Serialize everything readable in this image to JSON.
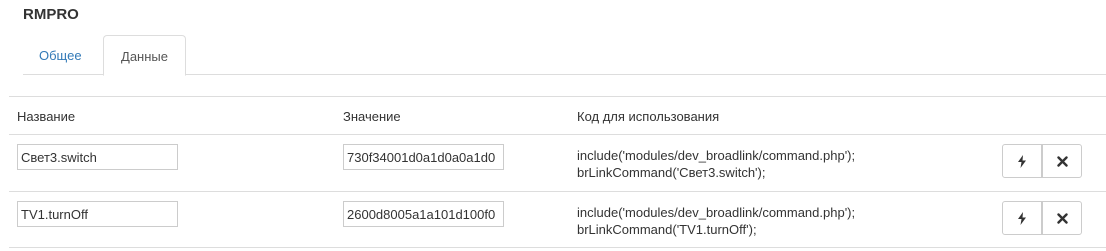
{
  "header": {
    "title": "RMPRO"
  },
  "tabs": [
    {
      "label": "Общее",
      "active": false
    },
    {
      "label": "Данные",
      "active": true
    }
  ],
  "table": {
    "columns": [
      "Название",
      "Значение",
      "Код для использования"
    ],
    "rows": [
      {
        "name": "Свет3.switch",
        "value": "730f34001d0a1d0a0a1d0",
        "code_line1": "include('modules/dev_broadlink/command.php');",
        "code_line2": "brLinkCommand('Свет3.switch');"
      },
      {
        "name": "TV1.turnOff",
        "value": "2600d8005a1a101d100f0",
        "code_line1": "include('modules/dev_broadlink/command.php');",
        "code_line2": "brLinkCommand('TV1.turnOff');"
      }
    ]
  },
  "icons": {
    "run": "bolt-icon",
    "delete": "close-icon"
  },
  "colors": {
    "link": "#337ab7",
    "border": "#dddddd",
    "text": "#333333"
  }
}
